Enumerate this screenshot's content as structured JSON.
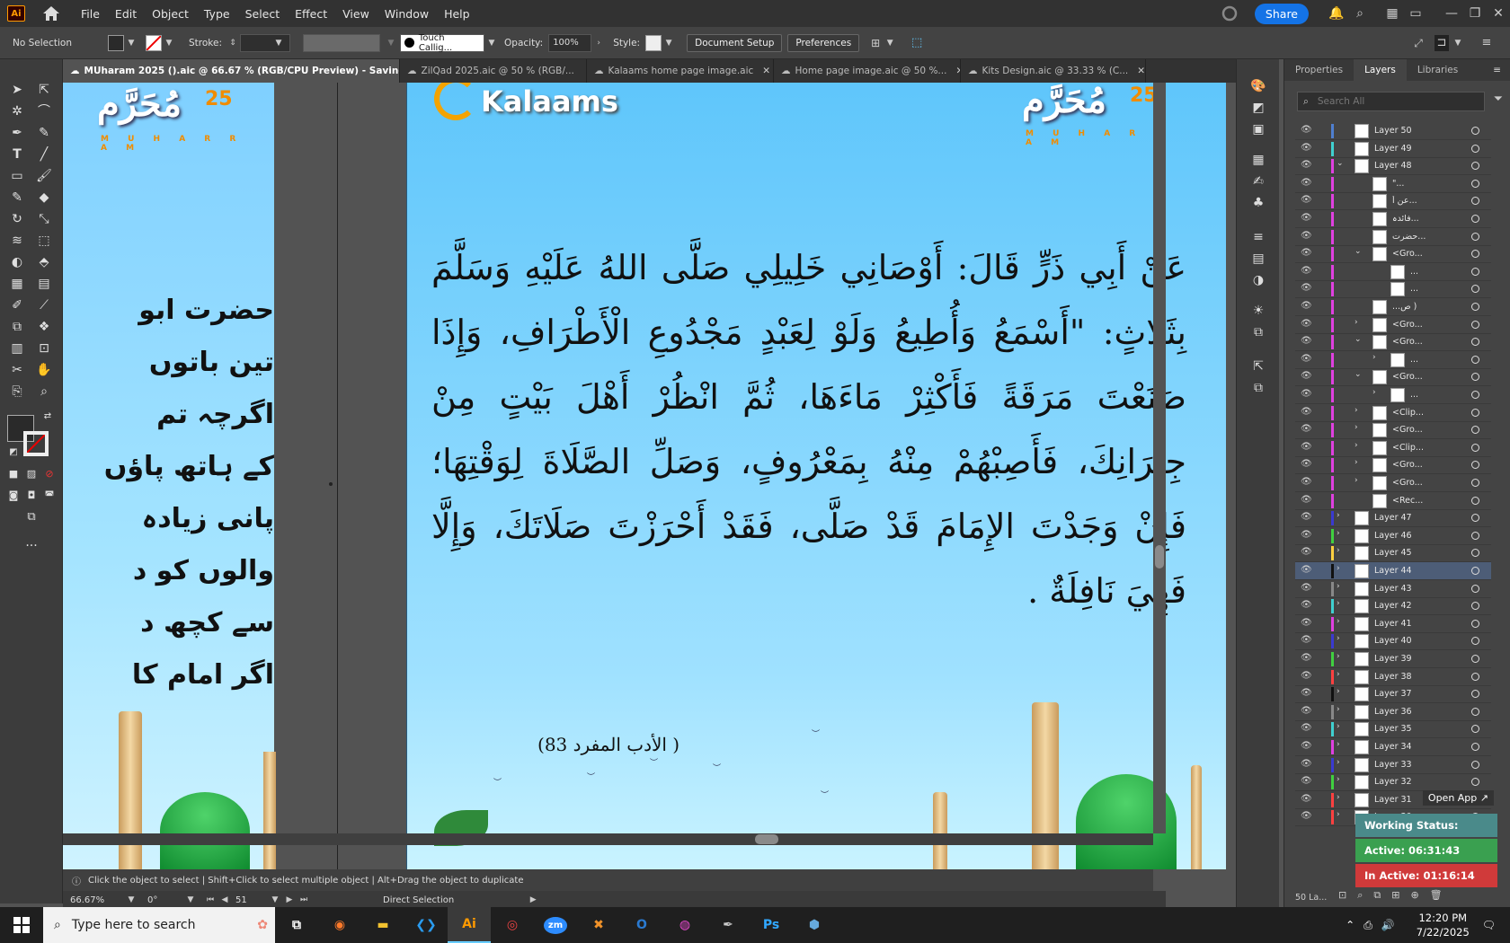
{
  "menubar": {
    "logo": "Ai",
    "items": [
      "File",
      "Edit",
      "Object",
      "Type",
      "Select",
      "Effect",
      "View",
      "Window",
      "Help"
    ],
    "share": "Share"
  },
  "control": {
    "selection": "No Selection",
    "stroke_label": "Stroke:",
    "brush": "Touch Callig...",
    "opacity_label": "Opacity:",
    "opacity": "100%",
    "style_label": "Style:",
    "document_setup": "Document Setup",
    "preferences": "Preferences"
  },
  "tabs": [
    {
      "label": "MUharam 2025 ().aic @ 66.67 % (RGB/CPU Preview)  - Saving 63%",
      "active": true
    },
    {
      "label": "ZilQad 2025.aic @ 50 % (RGB/..."
    },
    {
      "label": "Kalaams home page image.aic"
    },
    {
      "label": "Home page image.aic @ 50 %..."
    },
    {
      "label": "Kits Design.aic @ 33.33 % (C..."
    }
  ],
  "artwork": {
    "brand": "Kalaams",
    "muharram_arabic": "مُحَرَّم",
    "muharram_number": "25",
    "muharram_latin": "M U H A R R A M",
    "arabic_text": "عَنْ أَبِي ذَرٍّ قَالَ: أَوْصَانِي خَلِيلِي صَلَّى اللهُ عَلَيْهِ وَسَلَّمَ بِثَلَاثٍ: \"أَسْمَعُ وَأُطِيعُ وَلَوْ لِعَبْدٍ مَجْدُوعِ الْأَطْرَافِ، وَإِذَا صَنَعْتَ مَرَقَةً فَأَكْثِرْ مَاءَهَا، ثُمَّ انْظُرْ أَهْلَ بَيْتٍ مِنْ جِيرَانِكَ، فَأَصِبْهُمْ مِنْهُ بِمَعْرُوفٍ، وَصَلِّ الصَّلَاةَ لِوَقْتِهَا؛ فَإِنْ وَجَدْتَ الإِمَامَ قَدْ صَلَّى، فَقَدْ أَحْرَزْتَ صَلَاتَكَ، وَإِلَّا فَهِيَ نَافِلَةٌ .",
    "reference": "(الأدب المفرد 83 )",
    "urdu_lines": [
      "حضرت ابو",
      "تین باتوں",
      "اگرچہ تم",
      "کے ہاتھ پاؤں",
      "پانی زیادہ",
      "والوں کو د",
      "سے کچھ د",
      "اگر امام کا"
    ]
  },
  "hint": "Click the object to select   |   Shift+Click to select multiple object   |   Alt+Drag the object to duplicate",
  "status": {
    "zoom": "66.67%",
    "rotation": "0°",
    "artboard": "51",
    "tool": "Direct Selection"
  },
  "panel": {
    "tabs": [
      "Properties",
      "Layers",
      "Libraries"
    ],
    "active_tab": "Layers",
    "search_placeholder": "Search All",
    "layers": [
      {
        "name": "Layer 50",
        "color": "#4f7fd0",
        "indent": 0,
        "twirl": ""
      },
      {
        "name": "Layer 49",
        "color": "#3fd0d0",
        "indent": 0,
        "twirl": ""
      },
      {
        "name": "Layer 48",
        "color": "#e040e0",
        "indent": 0,
        "twirl": "v"
      },
      {
        "name": "\"...",
        "color": "#e040e0",
        "indent": 1,
        "twirl": ""
      },
      {
        "name": "عن أ...",
        "color": "#e040e0",
        "indent": 1,
        "twirl": ""
      },
      {
        "name": "فائدہ...",
        "color": "#e040e0",
        "indent": 1,
        "twirl": ""
      },
      {
        "name": "حضرت...",
        "color": "#e040e0",
        "indent": 1,
        "twirl": ""
      },
      {
        "name": "<Gro...",
        "color": "#e040e0",
        "indent": 1,
        "twirl": "v"
      },
      {
        "name": "...",
        "color": "#e040e0",
        "indent": 2,
        "twirl": ""
      },
      {
        "name": "...",
        "color": "#e040e0",
        "indent": 2,
        "twirl": ""
      },
      {
        "name": "...ص )",
        "color": "#e040e0",
        "indent": 1,
        "twirl": ""
      },
      {
        "name": "<Gro...",
        "color": "#e040e0",
        "indent": 1,
        "twirl": ">"
      },
      {
        "name": "<Gro...",
        "color": "#e040e0",
        "indent": 1,
        "twirl": "v"
      },
      {
        "name": "...",
        "color": "#e040e0",
        "indent": 2,
        "twirl": ">"
      },
      {
        "name": "<Gro...",
        "color": "#e040e0",
        "indent": 1,
        "twirl": "v"
      },
      {
        "name": "...",
        "color": "#e040e0",
        "indent": 2,
        "twirl": ">"
      },
      {
        "name": "<Clip...",
        "color": "#e040e0",
        "indent": 1,
        "twirl": ">"
      },
      {
        "name": "<Gro...",
        "color": "#e040e0",
        "indent": 1,
        "twirl": ">"
      },
      {
        "name": "<Clip...",
        "color": "#e040e0",
        "indent": 1,
        "twirl": ">"
      },
      {
        "name": "<Gro...",
        "color": "#e040e0",
        "indent": 1,
        "twirl": ">"
      },
      {
        "name": "<Gro...",
        "color": "#e040e0",
        "indent": 1,
        "twirl": ">"
      },
      {
        "name": "<Rec...",
        "color": "#e040e0",
        "indent": 1,
        "twirl": ""
      },
      {
        "name": "Layer 47",
        "color": "#3a3ad0",
        "indent": 0,
        "twirl": ">"
      },
      {
        "name": "Layer 46",
        "color": "#40d040",
        "indent": 0,
        "twirl": ">"
      },
      {
        "name": "Layer 45",
        "color": "#ffd040",
        "indent": 0,
        "twirl": ">"
      },
      {
        "name": "Layer 44",
        "color": "#111111",
        "indent": 0,
        "twirl": ">",
        "selected": true
      },
      {
        "name": "Layer 43",
        "color": "#888888",
        "indent": 0,
        "twirl": ">"
      },
      {
        "name": "Layer 42",
        "color": "#3fd0d0",
        "indent": 0,
        "twirl": ">"
      },
      {
        "name": "Layer 41",
        "color": "#e040e0",
        "indent": 0,
        "twirl": ">"
      },
      {
        "name": "Layer 40",
        "color": "#3a3ad0",
        "indent": 0,
        "twirl": ">"
      },
      {
        "name": "Layer 39",
        "color": "#40d040",
        "indent": 0,
        "twirl": ">"
      },
      {
        "name": "Layer 38",
        "color": "#ff4040",
        "indent": 0,
        "twirl": ">"
      },
      {
        "name": "Layer 37",
        "color": "#111111",
        "indent": 0,
        "twirl": ">"
      },
      {
        "name": "Layer 36",
        "color": "#888888",
        "indent": 0,
        "twirl": ">"
      },
      {
        "name": "Layer 35",
        "color": "#3fd0d0",
        "indent": 0,
        "twirl": ">"
      },
      {
        "name": "Layer 34",
        "color": "#e040e0",
        "indent": 0,
        "twirl": ">"
      },
      {
        "name": "Layer 33",
        "color": "#3a3ad0",
        "indent": 0,
        "twirl": ">"
      },
      {
        "name": "Layer 32",
        "color": "#40d040",
        "indent": 0,
        "twirl": ">"
      },
      {
        "name": "Layer 31",
        "color": "#ff4040",
        "indent": 0,
        "twirl": ">"
      },
      {
        "name": "Layer 30",
        "color": "#ff4040",
        "indent": 0,
        "twirl": ">"
      }
    ],
    "footer": "50 La..."
  },
  "overlay": {
    "open_app": "Open App ↗",
    "working_status": "Working Status: Active",
    "active_time": "Active: 06:31:43",
    "inactive_time": "In Active: 01:16:14"
  },
  "taskbar": {
    "search_placeholder": "Type here to search",
    "time": "12:20 PM",
    "date": "7/22/2025"
  }
}
